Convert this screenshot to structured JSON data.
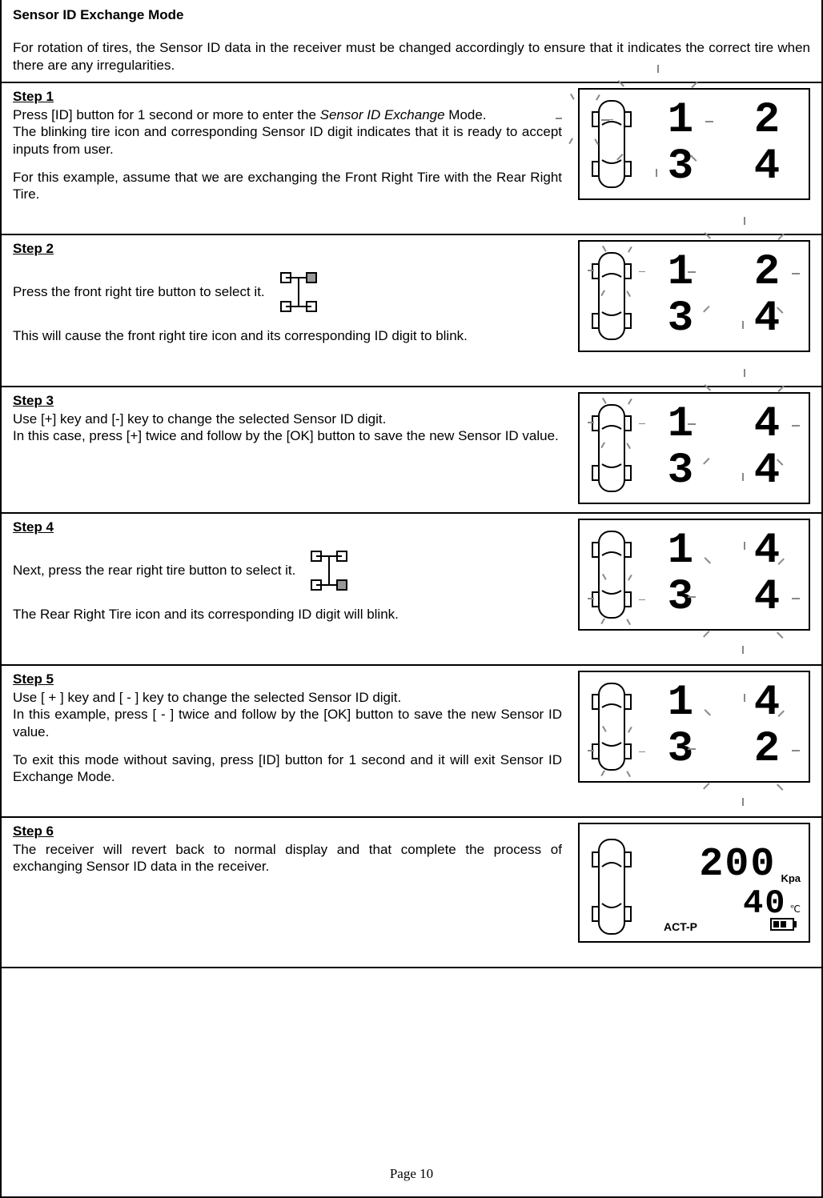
{
  "title": "Sensor ID Exchange Mode",
  "intro": "For rotation of tires, the Sensor ID data in the receiver must be changed accordingly to ensure that it indicates the correct tire when there are any irregularities.",
  "steps": {
    "s1": {
      "label": "Step 1",
      "line1": "Press [ID] button for 1 second or more to enter the ",
      "mode_name": "Sensor ID Exchange",
      "line1b": " Mode.",
      "line2": "The blinking tire icon and corresponding Sensor ID digit indicates that it is ready to accept inputs from user.",
      "line3": "For this example, assume that we are exchanging the Front Right Tire with the Rear Right Tire.",
      "digits": [
        "1",
        "2",
        "3",
        "4"
      ],
      "blink_digit_index": 0,
      "blink_tire": "FL"
    },
    "s2": {
      "label": "Step 2",
      "line1": "Press the front right tire button to select it.",
      "line2": "This will cause the front right tire icon and its corresponding ID digit to blink.",
      "digits": [
        "1",
        "2",
        "3",
        "4"
      ],
      "blink_digit_index": 1,
      "blink_tire": "FR",
      "schema_highlight": "FR"
    },
    "s3": {
      "label": "Step 3",
      "line1": "Use [+] key and [-] key to change the selected Sensor ID digit.",
      "line2": "In this case, press [+] twice and follow by the [OK] button to save the new Sensor ID value.",
      "digits": [
        "1",
        "4",
        "3",
        "4"
      ],
      "blink_digit_index": 1,
      "blink_tire": "FR"
    },
    "s4": {
      "label": "Step 4",
      "line1": "Next, press the rear right tire button to select it.",
      "line2": "The Rear Right Tire icon and its corresponding ID digit will blink.",
      "digits": [
        "1",
        "4",
        "3",
        "4"
      ],
      "blink_digit_index": 3,
      "blink_tire": "RR",
      "schema_highlight": "RR"
    },
    "s5": {
      "label": "Step 5",
      "line1": "Use [ + ] key and [ - ] key to change the selected Sensor ID digit.",
      "line2": "In this example, press [ - ] twice and follow by the [OK] button to save the new Sensor ID value.",
      "line3": "To exit this mode without saving, press [ID] button for 1 second and it will exit Sensor ID Exchange Mode.",
      "digits": [
        "1",
        "4",
        "3",
        "2"
      ],
      "blink_digit_index": 3,
      "blink_tire": "RR"
    },
    "s6": {
      "label": "Step 6",
      "line1": "The receiver will revert back to normal display and that complete the process of exchanging Sensor ID data in the receiver.",
      "pressure": "200",
      "pressure_unit": "Kpa",
      "temp": "40",
      "temp_unit": "℃",
      "mode": "ACT-P"
    }
  },
  "footer": "Page 10"
}
